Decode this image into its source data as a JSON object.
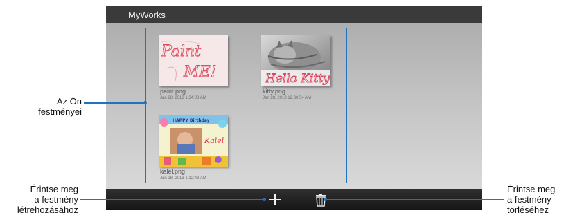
{
  "app": {
    "title": "MyWorks"
  },
  "files": [
    {
      "name": "paint.png",
      "date": "Jan 28, 2013 1:34:08 AM",
      "thumb_text": "Paint ME!"
    },
    {
      "name": "kitty.png",
      "date": "Jan 28, 2013 12:30:54 AM",
      "thumb_text": "Hello Kitty"
    },
    {
      "name": "kalel.png",
      "date": "Jan 28, 2013 1:12:43 AM",
      "thumb_text": "HAPPY Birthday Kalel"
    }
  ],
  "toolbar": {
    "add_icon": "plus-icon",
    "delete_icon": "trash-icon"
  },
  "callouts": {
    "paintings": [
      "Az Ön",
      "festményei"
    ],
    "create": [
      "Érintse meg",
      "a festmény",
      "létrehozásához"
    ],
    "delete": [
      "Érintse meg",
      "a festmény",
      "törléséhez"
    ]
  },
  "colors": {
    "accent": "#1f74bf",
    "titlebar": "#3a3a3a",
    "bottombar": "#1e1e1e"
  }
}
